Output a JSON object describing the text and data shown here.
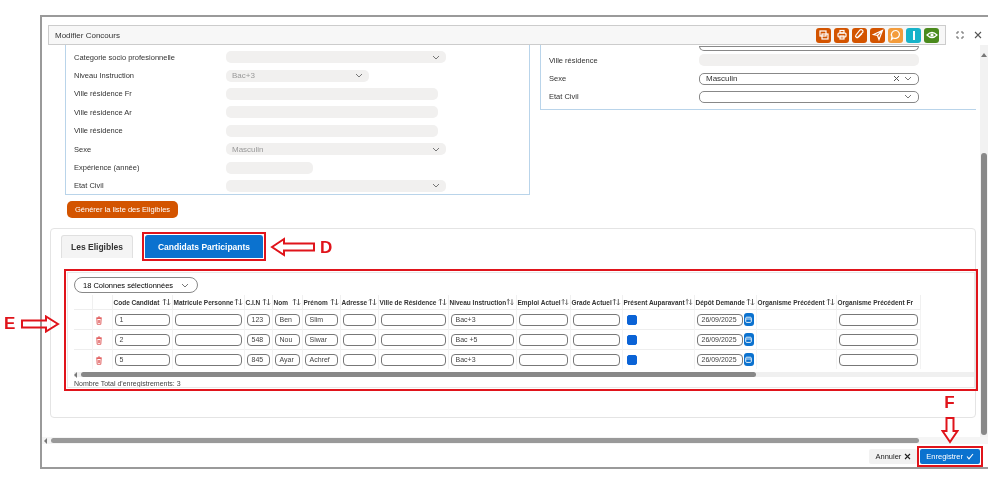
{
  "dialog": {
    "title": "Modifier Concours",
    "toolbar": [
      {
        "kind": "documents",
        "color": "#d35400"
      },
      {
        "kind": "print",
        "color": "#d35400"
      },
      {
        "kind": "attach",
        "color": "#d35400"
      },
      {
        "kind": "send",
        "color": "#d35400"
      },
      {
        "kind": "comment",
        "color": "#f39c3c"
      },
      {
        "kind": "info",
        "color": "#17b3c9"
      },
      {
        "kind": "view",
        "color": "#4a8a1c"
      }
    ]
  },
  "left_form": {
    "fields": [
      {
        "label": "Categorie socio profesionnelle",
        "kind": "select",
        "disabled": true
      },
      {
        "label": "Niveau Instruction",
        "kind": "select",
        "disabled": true,
        "value": "Bac+3"
      },
      {
        "label": "Ville résidence Fr",
        "kind": "input",
        "disabled": true
      },
      {
        "label": "Ville résidence Ar",
        "kind": "input",
        "disabled": true
      },
      {
        "label": "Ville résidence",
        "kind": "input",
        "disabled": true
      },
      {
        "label": "Sexe",
        "kind": "select",
        "disabled": true,
        "value": "Masculin"
      },
      {
        "label": "Expérience (année)",
        "kind": "input",
        "disabled": true
      },
      {
        "label": "Etat Civil",
        "kind": "select",
        "disabled": true
      }
    ]
  },
  "right_form": {
    "fields": [
      {
        "kind": "input",
        "disabled": false
      },
      {
        "label": "Ville résidence",
        "kind": "input",
        "disabled": true
      },
      {
        "label": "Sexe",
        "kind": "select",
        "disabled": false,
        "value": "Masculin",
        "clearable": true
      },
      {
        "label": "Etat Civil",
        "kind": "select",
        "disabled": false
      }
    ]
  },
  "generate_button": "Générer la liste des Eligibles",
  "tabs": [
    {
      "label": "Les Eligibles",
      "selected": false
    },
    {
      "label": "Candidats Participants",
      "selected": true
    }
  ],
  "table": {
    "column_selector": "18 Colonnes sélectionnées",
    "columns": [
      "Code Candidat",
      "Matricule Personne",
      "C.I.N",
      "Nom",
      "Prénom",
      "Adresse",
      "Ville de Résidence",
      "Niveau Instruction",
      "Emploi Actuel",
      "Grade Actuel",
      "Présent Auparavant",
      "Dépôt Demande",
      "Organisme Précédent",
      "Organisme Précédent Fr"
    ],
    "rows": [
      {
        "cells": [
          {
            "kind": "input",
            "value": "1"
          },
          {
            "kind": "input"
          },
          {
            "kind": "input",
            "value": "123"
          },
          {
            "kind": "input",
            "value": "Ben"
          },
          {
            "kind": "input",
            "value": "Slim"
          },
          {
            "kind": "input"
          },
          {
            "kind": "input"
          },
          {
            "kind": "input",
            "value": "Bac+3"
          },
          {
            "kind": "input"
          },
          {
            "kind": "input"
          },
          {
            "kind": "checkbox",
            "checked": true
          },
          {
            "kind": "date",
            "value": "26/09/2025"
          },
          {
            "kind": "blank"
          },
          {
            "kind": "input"
          }
        ]
      },
      {
        "cells": [
          {
            "kind": "input",
            "value": "2"
          },
          {
            "kind": "input"
          },
          {
            "kind": "input",
            "value": "548"
          },
          {
            "kind": "input",
            "value": "Nou"
          },
          {
            "kind": "input",
            "value": "Siwar"
          },
          {
            "kind": "input"
          },
          {
            "kind": "input"
          },
          {
            "kind": "input",
            "value": "Bac +5"
          },
          {
            "kind": "input"
          },
          {
            "kind": "input"
          },
          {
            "kind": "checkbox",
            "checked": true
          },
          {
            "kind": "date",
            "value": "26/09/2025"
          },
          {
            "kind": "blank"
          },
          {
            "kind": "input"
          }
        ]
      },
      {
        "cells": [
          {
            "kind": "input",
            "value": "5"
          },
          {
            "kind": "input"
          },
          {
            "kind": "input",
            "value": "845"
          },
          {
            "kind": "input",
            "value": "Ayar"
          },
          {
            "kind": "input",
            "value": "Achref"
          },
          {
            "kind": "input"
          },
          {
            "kind": "input"
          },
          {
            "kind": "input",
            "value": "Bac+3"
          },
          {
            "kind": "input"
          },
          {
            "kind": "input"
          },
          {
            "kind": "checkbox",
            "checked": true
          },
          {
            "kind": "date",
            "value": "26/09/2025"
          },
          {
            "kind": "blank"
          },
          {
            "kind": "input"
          }
        ]
      }
    ],
    "total": "Nombre Total d'enregistrements: 3"
  },
  "footer": {
    "buttons": [
      {
        "label": "Annuler",
        "kind": "cancel"
      },
      {
        "label": "Enregistrer",
        "kind": "save"
      }
    ]
  },
  "annotations": [
    {
      "label": "D"
    },
    {
      "label": "E"
    },
    {
      "label": "F"
    }
  ]
}
